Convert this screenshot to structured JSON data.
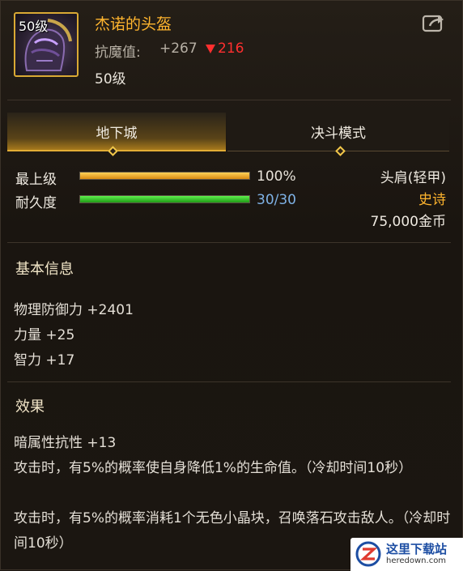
{
  "item": {
    "icon_level": "50级",
    "name": "杰诺的头盔",
    "resist_label": "抗魔值:",
    "resist_value": "+267",
    "resist_diff": "216",
    "required_level": "50级"
  },
  "tabs": [
    {
      "label": "地下城",
      "active": true
    },
    {
      "label": "决斗模式",
      "active": false
    }
  ],
  "bars": {
    "level": {
      "label": "最上级",
      "text": "100%",
      "fraction": 1.0
    },
    "durability": {
      "label": "耐久度",
      "text": "30/30",
      "fraction": 1.0
    }
  },
  "meta": {
    "slot": "头肩(轻甲)",
    "rarity": "史诗",
    "price": "75,000金币"
  },
  "basic": {
    "title": "基本信息",
    "stats": [
      "物理防御力 +2401",
      "力量 +25",
      "智力 +17"
    ]
  },
  "effects": {
    "title": "效果",
    "lines": [
      "暗属性抗性 +13",
      "攻击时，有5%的概率使自身降低1%的生命值。（冷却时间10秒）",
      "攻击时，有5%的概率消耗1个无色小晶块，召唤落石攻击敌人。（冷却时间10秒）"
    ]
  },
  "watermark": {
    "title": "这里下载站",
    "url": "heredown.com"
  },
  "colors": {
    "name": "#ffb52e",
    "rarity": "#ffb52e",
    "diff_down": "#ff2f2f",
    "durability_text": "#7fb2e6",
    "accent_gold": "#e2ad35"
  },
  "icons": [
    "helmet-icon",
    "share-icon",
    "down-arrow-icon",
    "diamond-marker-icon"
  ]
}
